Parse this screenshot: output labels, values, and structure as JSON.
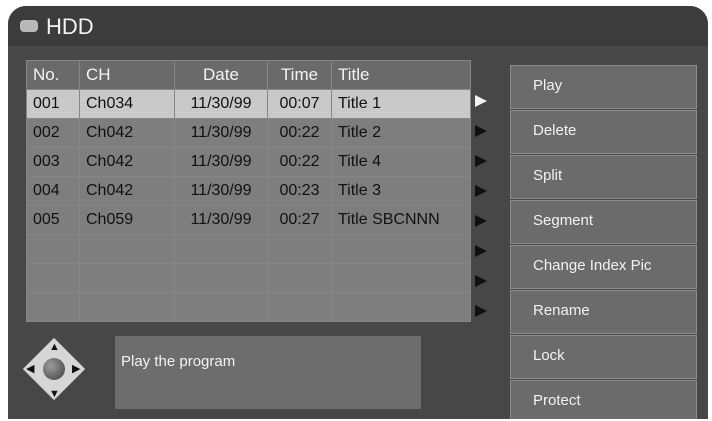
{
  "header": {
    "title": "HDD",
    "icon": "hdd-icon"
  },
  "table": {
    "columns": [
      "No.",
      "CH",
      "Date",
      "Time",
      "Title"
    ],
    "rows": [
      {
        "no": "001",
        "ch": "Ch034",
        "date": "11/30/99",
        "time": "00:07",
        "title": "Title 1"
      },
      {
        "no": "002",
        "ch": "Ch042",
        "date": "11/30/99",
        "time": "00:22",
        "title": "Title 2"
      },
      {
        "no": "003",
        "ch": "Ch042",
        "date": "11/30/99",
        "time": "00:22",
        "title": "Title 4"
      },
      {
        "no": "004",
        "ch": "Ch042",
        "date": "11/30/99",
        "time": "00:23",
        "title": "Title 3"
      },
      {
        "no": "005",
        "ch": "Ch059",
        "date": "11/30/99",
        "time": "00:27",
        "title": "Title SBCNNN"
      }
    ]
  },
  "menu": [
    "Play",
    "Delete",
    "Split",
    "Segment",
    "Change Index Pic",
    "Rename",
    "Lock",
    "Protect"
  ],
  "message": "Play the program",
  "colors": {
    "background": "#474747",
    "selected_row": "#c9c9c9",
    "row": "#7e7e7e",
    "menu_item": "#6b6b6b"
  }
}
